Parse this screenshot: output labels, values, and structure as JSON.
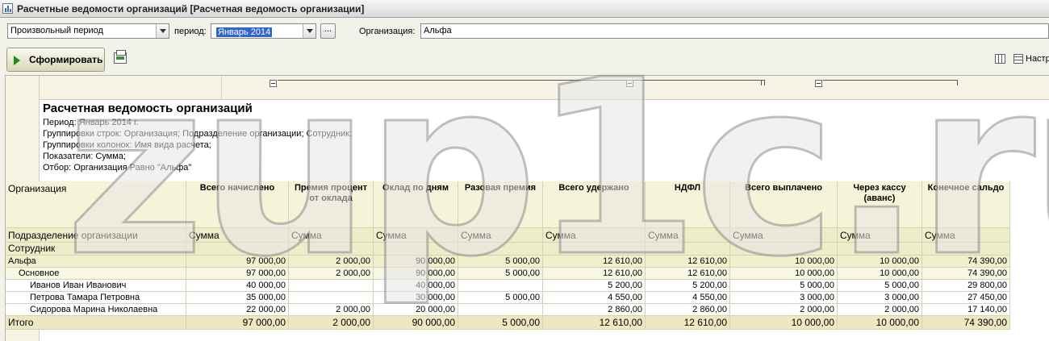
{
  "window": {
    "title": "Расчетные ведомости организаций [Расчетная ведомость организации]"
  },
  "filters": {
    "period_type": "Произвольный период",
    "period_label": "период:",
    "period_value": "Январь 2014",
    "ellipsis": "...",
    "org_label": "Организация:",
    "org_value": "Альфа"
  },
  "toolbar": {
    "generate_label": "Сформировать",
    "settings_label": "Настр"
  },
  "report": {
    "title": "Расчетная ведомость организаций",
    "lines": [
      "Период: Январь 2014 г.",
      "Группировки строк: Организация; Подразделение организации; Сотрудник;",
      "Группировки колонок: Имя вида расчета;",
      "Показатели: Сумма;",
      "Отбор: Организация Равно \"Альфа\""
    ],
    "row_header": {
      "org": "Организация",
      "dept": "Подразделение организации",
      "emp": "Сотрудник"
    },
    "columns": [
      {
        "title": "Всего начислено",
        "measure": "Сумма"
      },
      {
        "title": "Премия процент от оклада",
        "measure": "Сумма"
      },
      {
        "title": "Оклад по дням",
        "measure": "Сумма"
      },
      {
        "title": "Разовая премия",
        "measure": "Сумма"
      },
      {
        "title": "Всего удержано",
        "measure": "Сумма"
      },
      {
        "title": "НДФЛ",
        "measure": "Сумма"
      },
      {
        "title": "Всего выплачено",
        "measure": "Сумма"
      },
      {
        "title": "Через кассу (аванс)",
        "measure": "Сумма"
      },
      {
        "title": "Конечное сальдо",
        "measure": "Сумма"
      }
    ],
    "rows": [
      {
        "level": "org",
        "name": "Альфа",
        "values": [
          "97 000,00",
          "2 000,00",
          "90 000,00",
          "5 000,00",
          "12 610,00",
          "12 610,00",
          "10 000,00",
          "10 000,00",
          "74 390,00"
        ]
      },
      {
        "level": "dep",
        "name": "Основное",
        "values": [
          "97 000,00",
          "2 000,00",
          "90 000,00",
          "5 000,00",
          "12 610,00",
          "12 610,00",
          "10 000,00",
          "10 000,00",
          "74 390,00"
        ]
      },
      {
        "level": "emp",
        "name": "Иванов Иван Иванович",
        "values": [
          "40 000,00",
          "",
          "40 000,00",
          "",
          "5 200,00",
          "5 200,00",
          "5 000,00",
          "5 000,00",
          "29 800,00"
        ]
      },
      {
        "level": "emp",
        "name": "Петрова Тамара Петровна",
        "values": [
          "35 000,00",
          "",
          "30 000,00",
          "5 000,00",
          "4 550,00",
          "4 550,00",
          "3 000,00",
          "3 000,00",
          "27 450,00"
        ]
      },
      {
        "level": "emp",
        "name": "Сидорова Марина Николаевна",
        "values": [
          "22 000,00",
          "2 000,00",
          "20 000,00",
          "",
          "2 860,00",
          "2 860,00",
          "2 000,00",
          "2 000,00",
          "17 140,00"
        ]
      }
    ],
    "total": {
      "name": "Итого",
      "values": [
        "97 000,00",
        "2 000,00",
        "90 000,00",
        "5 000,00",
        "12 610,00",
        "12 610,00",
        "10 000,00",
        "10 000,00",
        "74 390,00"
      ]
    }
  },
  "watermark": {
    "text": "zup1c.ru"
  }
}
